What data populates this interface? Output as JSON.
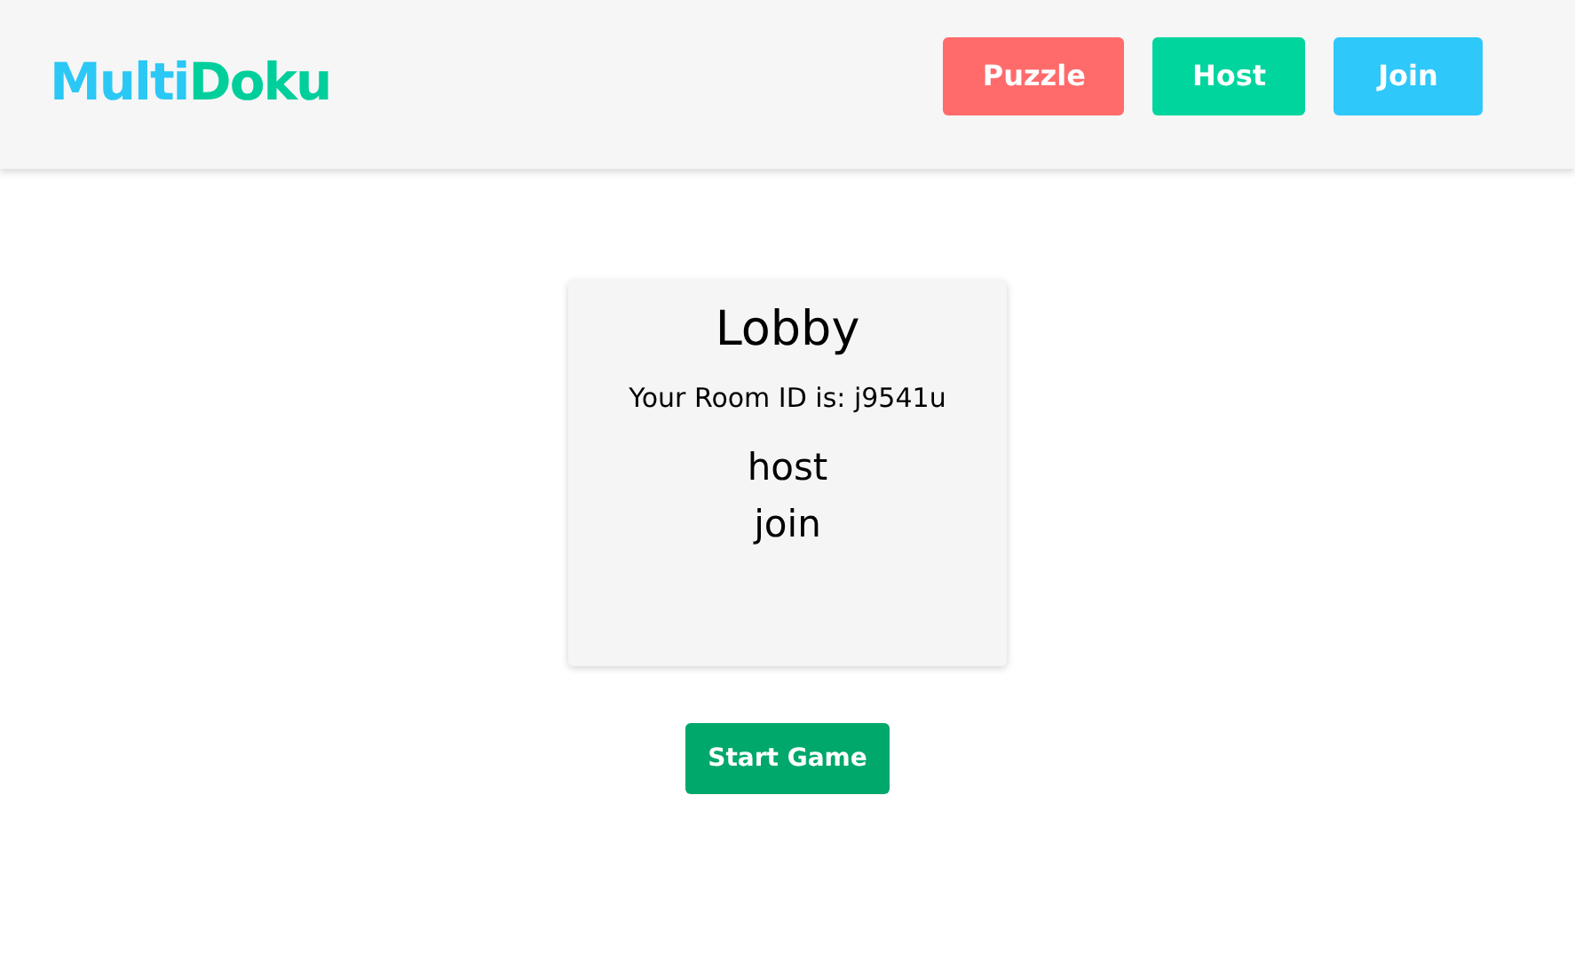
{
  "header": {
    "logo": [
      "Multi",
      "Doku"
    ],
    "nav": [
      {
        "label": "Puzzle",
        "color": "#ff6b6b"
      },
      {
        "label": "Host",
        "color": "#00d59e"
      },
      {
        "label": "Join",
        "color": "#2ec8fb"
      }
    ]
  },
  "lobby": {
    "title": "Lobby",
    "room_id": "Your Room ID is: j9541u",
    "players": [
      "host",
      "join"
    ]
  },
  "start_button": "Start Game"
}
